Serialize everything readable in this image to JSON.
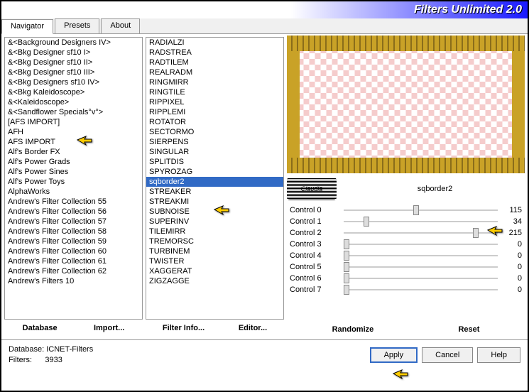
{
  "title": "Filters Unlimited 2.0",
  "tabs": [
    "Navigator",
    "Presets",
    "About"
  ],
  "active_tab": 0,
  "categories": [
    "&<Background Designers IV>",
    "&<Bkg Designer sf10 I>",
    "&<Bkg Designer sf10 II>",
    "&<Bkg Designer sf10 III>",
    "&<Bkg Designers sf10 IV>",
    "&<Bkg Kaleidoscope>",
    "&<Kaleidoscope>",
    "&<Sandflower Specials°v°>",
    "[AFS IMPORT]",
    "AFH",
    "AFS IMPORT",
    "Alf's Border FX",
    "Alf's Power Grads",
    "Alf's Power Sines",
    "Alf's Power Toys",
    "AlphaWorks",
    "Andrew's Filter Collection 55",
    "Andrew's Filter Collection 56",
    "Andrew's Filter Collection 57",
    "Andrew's Filter Collection 58",
    "Andrew's Filter Collection 59",
    "Andrew's Filter Collection 60",
    "Andrew's Filter Collection 61",
    "Andrew's Filter Collection 62",
    "Andrew's Filters 10"
  ],
  "filters": [
    "RADIALZI",
    "RADSTREA",
    "RADTILEM",
    "REALRADM",
    "RINGMIRR",
    "RINGTILE",
    "RIPPIXEL",
    "RIPPLEMI",
    "ROTATOR",
    "SECTORMO",
    "SIERPENS",
    "SINGULAR",
    "SPLITDIS",
    "SPYROZAG",
    "sqborder2",
    "STREAKER",
    "STREAKMI",
    "SUBNOISE",
    "SUPERINV",
    "TILEMIRR",
    "TREMORSC",
    "TURBINEM",
    "TWISTER",
    "XAGGERAT",
    "ZIGZAGGE"
  ],
  "selected_filter_index": 14,
  "selected_filter_name": "sqborder2",
  "category_buttons": {
    "database": "Database",
    "import": "Import..."
  },
  "filter_buttons": {
    "info": "Filter Info...",
    "editor": "Editor..."
  },
  "controls": [
    {
      "label": "Control 0",
      "value": 115,
      "pos": 45
    },
    {
      "label": "Control 1",
      "value": 34,
      "pos": 13
    },
    {
      "label": "Control 2",
      "value": 215,
      "pos": 84
    },
    {
      "label": "Control 3",
      "value": 0,
      "pos": 0
    },
    {
      "label": "Control 4",
      "value": 0,
      "pos": 0
    },
    {
      "label": "Control 5",
      "value": 0,
      "pos": 0
    },
    {
      "label": "Control 6",
      "value": 0,
      "pos": 0
    },
    {
      "label": "Control 7",
      "value": 0,
      "pos": 0
    }
  ],
  "control_buttons": {
    "randomize": "Randomize",
    "reset": "Reset"
  },
  "status": {
    "db_label": "Database:",
    "db_value": "ICNET-Filters",
    "filters_label": "Filters:",
    "filters_value": "3933"
  },
  "dialog_buttons": {
    "apply": "Apply",
    "cancel": "Cancel",
    "help": "Help"
  },
  "claudia": "Claudia"
}
